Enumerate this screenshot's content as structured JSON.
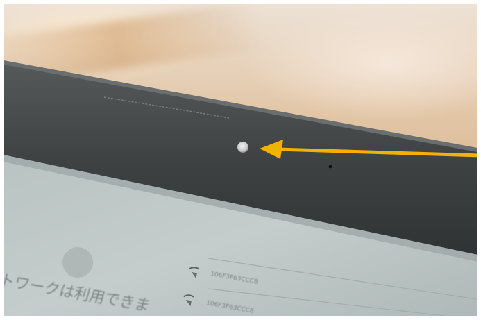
{
  "photo": {
    "subject": "laptop-top-bezel-with-webcam",
    "colors": {
      "background": "#d9b894",
      "bezel": "#3f4344",
      "screen": "#c3cccb",
      "arrow": "#f5b000",
      "camera": "#d8d8d8"
    },
    "screen": {
      "japanese_text": "トワークは利用できま",
      "network_list": [
        "106F3F63CCC8",
        "106F3F63CCC8"
      ]
    },
    "icons": [
      "webcam-icon",
      "sensor-dot-icon",
      "arrow-icon",
      "wifi-icon"
    ]
  }
}
